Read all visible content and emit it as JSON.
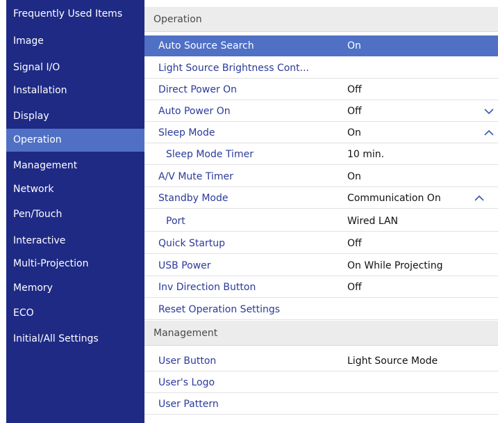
{
  "sidebar": {
    "items": [
      {
        "label": "Frequently Used Items"
      },
      {
        "label": "Image"
      },
      {
        "label": "Signal I/O"
      },
      {
        "label": "Installation"
      },
      {
        "label": "Display"
      },
      {
        "label": "Operation"
      },
      {
        "label": "Management"
      },
      {
        "label": "Network"
      },
      {
        "label": "Pen/Touch"
      },
      {
        "label": "Interactive"
      },
      {
        "label": "Multi-Projection"
      },
      {
        "label": "Memory"
      },
      {
        "label": "ECO"
      },
      {
        "label": "Initial/All Settings"
      }
    ]
  },
  "main": {
    "operation_header": "Operation",
    "operation_rows": [
      {
        "label": "Auto Source Search",
        "value": "On"
      },
      {
        "label": "Light Source Brightness Cont...",
        "value": ""
      },
      {
        "label": "Direct Power On",
        "value": "Off"
      },
      {
        "label": "Auto Power On",
        "value": "Off"
      },
      {
        "label": "Sleep Mode",
        "value": "On"
      },
      {
        "label": "Sleep Mode Timer",
        "value": "10 min."
      },
      {
        "label": "A/V Mute Timer",
        "value": "On"
      },
      {
        "label": "Standby Mode",
        "value": "Communication On"
      },
      {
        "label": "Port",
        "value": "Wired LAN"
      },
      {
        "label": "Quick Startup",
        "value": "Off"
      },
      {
        "label": "USB Power",
        "value": "On While Projecting"
      },
      {
        "label": "Inv Direction Button",
        "value": "Off"
      },
      {
        "label": "Reset Operation Settings",
        "value": ""
      }
    ],
    "management_header": "Management",
    "management_rows": [
      {
        "label": "User Button",
        "value": "Light Source Mode"
      },
      {
        "label": "User's Logo",
        "value": ""
      },
      {
        "label": "User Pattern",
        "value": ""
      }
    ]
  },
  "icons": {
    "collapse": "chevron-down-icon",
    "expand": "chevron-up-icon"
  },
  "colors": {
    "sidebar_bg": "#1f2a85",
    "highlight": "#4f70c5",
    "label_text": "#2b3a9a",
    "section_bg": "#ececec"
  }
}
